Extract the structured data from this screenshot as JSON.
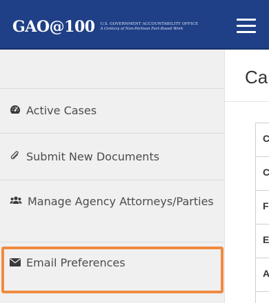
{
  "header": {
    "logo_main": "GAO@100",
    "logo_sub_line1": "U.S. GOVERNMENT ACCOUNTABILITY OFFICE",
    "logo_sub_line2": "A Century of Non-Partisan Fact-Based Work",
    "menu_icon": "hamburger-menu-icon",
    "background_color": "#1f3f86"
  },
  "sidebar": {
    "items": [
      {
        "label": "Active Cases",
        "icon": "tachometer-icon"
      },
      {
        "label": "Submit New Documents",
        "icon": "paperclip-icon"
      },
      {
        "label": "Manage Agency Attorneys/Parties",
        "icon": "users-icon"
      },
      {
        "label": "Email Preferences",
        "icon": "envelope-icon"
      }
    ],
    "highlight_color": "#f08a40"
  },
  "main": {
    "title": "Ca",
    "table_rows": [
      "C",
      "C",
      "F",
      "E",
      "A"
    ]
  }
}
